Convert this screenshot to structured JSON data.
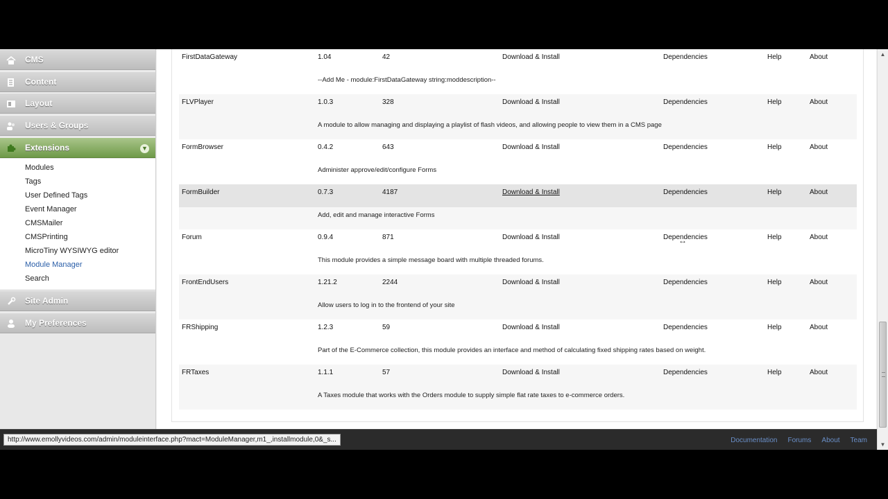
{
  "sidebar": {
    "sections": [
      {
        "label": "CMS",
        "icon": "home-icon"
      },
      {
        "label": "Content",
        "icon": "document-icon"
      },
      {
        "label": "Layout",
        "icon": "layout-icon"
      },
      {
        "label": "Users & Groups",
        "icon": "users-icon"
      },
      {
        "label": "Extensions",
        "icon": "puzzle-icon"
      }
    ],
    "extensions_items": [
      "Modules",
      "Tags",
      "User Defined Tags",
      "Event Manager",
      "CMSMailer",
      "CMSPrinting",
      "MicroTiny WYSIWYG editor",
      "Module Manager",
      "Search"
    ],
    "after_sections": [
      {
        "label": "Site Admin",
        "icon": "wrench-icon"
      },
      {
        "label": "My Preferences",
        "icon": "user-icon"
      }
    ],
    "active_section": "Extensions",
    "current_item": "Module Manager"
  },
  "modules": [
    {
      "name": "FirstDataGateway",
      "version": "1.04",
      "downloads": "42",
      "install": "Download & Install",
      "deps": "Dependencies",
      "help": "Help",
      "about": "About",
      "description": "--Add Me - module:FirstDataGateway string:moddescription--"
    },
    {
      "name": "FLVPlayer",
      "version": "1.0.3",
      "downloads": "328",
      "install": "Download & Install",
      "deps": "Dependencies",
      "help": "Help",
      "about": "About",
      "description": "A module to allow managing and displaying a playlist of flash videos, and allowing people to view them in a CMS page"
    },
    {
      "name": "FormBrowser",
      "version": "0.4.2",
      "downloads": "643",
      "install": "Download & Install",
      "deps": "Dependencies",
      "help": "Help",
      "about": "About",
      "description": "Administer approve/edit/configure Forms"
    },
    {
      "name": "FormBuilder",
      "version": "0.7.3",
      "downloads": "4187",
      "install": "Download & Install",
      "deps": "Dependencies",
      "help": "Help",
      "about": "About",
      "description": "Add, edit and manage interactive Forms"
    },
    {
      "name": "Forum",
      "version": "0.9.4",
      "downloads": "871",
      "install": "Download & Install",
      "deps": "Dependencies",
      "help": "Help",
      "about": "About",
      "description": "This module provides a simple message board with multiple threaded forums."
    },
    {
      "name": "FrontEndUsers",
      "version": "1.21.2",
      "downloads": "2244",
      "install": "Download & Install",
      "deps": "Dependencies",
      "help": "Help",
      "about": "About",
      "description": "Allow users to log in to the frontend of your site"
    },
    {
      "name": "FRShipping",
      "version": "1.2.3",
      "downloads": "59",
      "install": "Download & Install",
      "deps": "Dependencies",
      "help": "Help",
      "about": "About",
      "description": "Part of the E-Commerce collection, this module provides an interface and method of calculating fixed shipping rates based on weight."
    },
    {
      "name": "FRTaxes",
      "version": "1.1.1",
      "downloads": "57",
      "install": "Download & Install",
      "deps": "Dependencies",
      "help": "Help",
      "about": "About",
      "description": "A Taxes module that works with the Orders module to supply simple flat rate taxes to e-commerce orders."
    }
  ],
  "hovered_module_index": 3,
  "status": {
    "url": "http://www.emollyvideos.com/admin/moduleinterface.php?mact=ModuleManager,m1_,installmodule,0&_s..."
  },
  "footer": {
    "links": [
      "Documentation",
      "Forums",
      "About",
      "Team"
    ]
  },
  "colors": {
    "active_section": "#7fa857",
    "link": "#2a5ea8",
    "footer_link": "#6a8fc8"
  }
}
